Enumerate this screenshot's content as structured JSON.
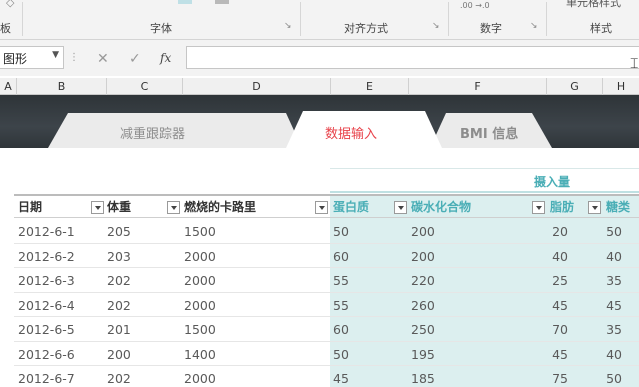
{
  "ribbon": {
    "groups": {
      "clipboard": "板",
      "font": "字体",
      "alignment": "对齐方式",
      "number": "数字",
      "styles": "样式"
    },
    "cell_styles_partial": "单元格样式",
    "decimal_icons": ".00 →.0"
  },
  "formula_bar": {
    "name_box": "图形",
    "cancel": "✕",
    "enter": "✓",
    "fx": "fx",
    "formula": ""
  },
  "columns": [
    "A",
    "B",
    "C",
    "D",
    "E",
    "F",
    "G",
    "H"
  ],
  "tabs": [
    {
      "label": "减重跟踪器",
      "active": false
    },
    {
      "label": "数据输入",
      "active": true
    },
    {
      "label": "BMI 信息",
      "active": false
    }
  ],
  "table": {
    "group_header": "摄入量",
    "headers": [
      "日期",
      "体重",
      "燃烧的卡路里",
      "蛋白质",
      "碳水化合物",
      "脂肪",
      "糖类"
    ],
    "rows": [
      [
        "2012-6-1",
        "205",
        "1500",
        "50",
        "200",
        "20",
        "50"
      ],
      [
        "2012-6-2",
        "203",
        "2000",
        "60",
        "200",
        "40",
        "40"
      ],
      [
        "2012-6-3",
        "202",
        "2000",
        "55",
        "220",
        "25",
        "35"
      ],
      [
        "2012-6-4",
        "202",
        "2000",
        "55",
        "260",
        "45",
        "45"
      ],
      [
        "2012-6-5",
        "201",
        "1500",
        "60",
        "250",
        "70",
        "35"
      ],
      [
        "2012-6-6",
        "200",
        "1400",
        "50",
        "195",
        "45",
        "40"
      ],
      [
        "2012-6-7",
        "202",
        "2000",
        "45",
        "185",
        "75",
        "50"
      ]
    ]
  },
  "colors": {
    "accent_teal": "#4aaeb6",
    "active_tab_red": "#e8424a",
    "intake_fill": "#dcefef",
    "band_dark": "#353b40"
  }
}
